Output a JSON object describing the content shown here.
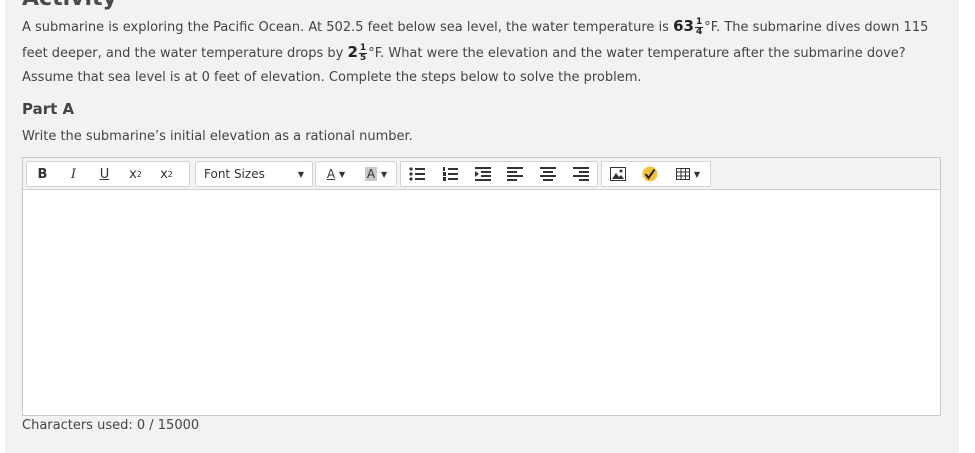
{
  "heading": "Activity",
  "problem": {
    "part1": "A submarine is exploring the Pacific Ocean. At 502.5 feet below sea level, the water temperature is ",
    "temp_whole": "63",
    "temp_num": "1",
    "temp_den": "4",
    "part2": "°F. The submarine dives down 115 feet deeper, and the water temperature drops by ",
    "drop_whole": "2",
    "drop_num": "1",
    "drop_den": "5",
    "part3": "°F. What were the elevation and the water temperature after the submarine dove? Assume that sea level is at 0 feet of elevation. Complete the steps below to solve the problem."
  },
  "part": {
    "title": "Part A",
    "prompt": "Write the submarine’s initial elevation as a rational number."
  },
  "toolbar": {
    "bold": "B",
    "italic": "I",
    "underline": "U",
    "superscript": "x",
    "superscript_mark": "2",
    "subscript": "x",
    "subscript_mark": "2",
    "font_sizes": "Font Sizes",
    "font_color": "A",
    "bg_color": "A",
    "icons": [
      "bullet-list-icon",
      "numbered-list-icon",
      "indent-icon",
      "align-left-icon",
      "align-center-icon",
      "align-right-icon",
      "image-icon",
      "math-icon",
      "table-icon"
    ]
  },
  "editor": {
    "value": "",
    "chars_used": "Characters used: 0 / 15000"
  }
}
